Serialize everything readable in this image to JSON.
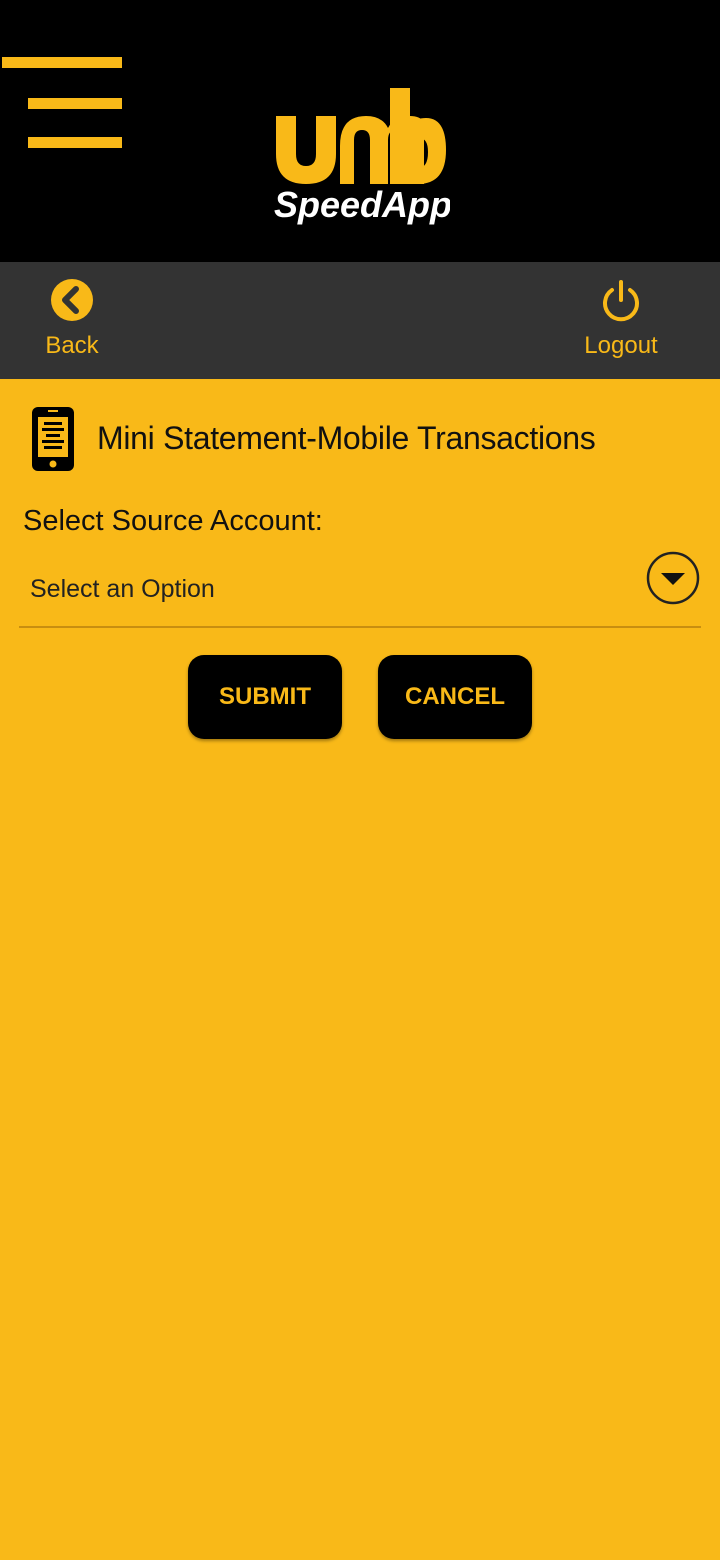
{
  "app": {
    "logo_text": "umb",
    "logo_subtitle": "SpeedApp"
  },
  "toolbar": {
    "back_label": "Back",
    "logout_label": "Logout"
  },
  "page": {
    "title": "Mini Statement-Mobile Transactions",
    "source_label": "Select Source Account:",
    "select": {
      "value": "Select an Option"
    },
    "submit_label": "SUBMIT",
    "cancel_label": "CANCEL"
  },
  "colors": {
    "accent": "#F9B918",
    "header_bg": "#000000",
    "toolbar_bg": "#333333"
  }
}
